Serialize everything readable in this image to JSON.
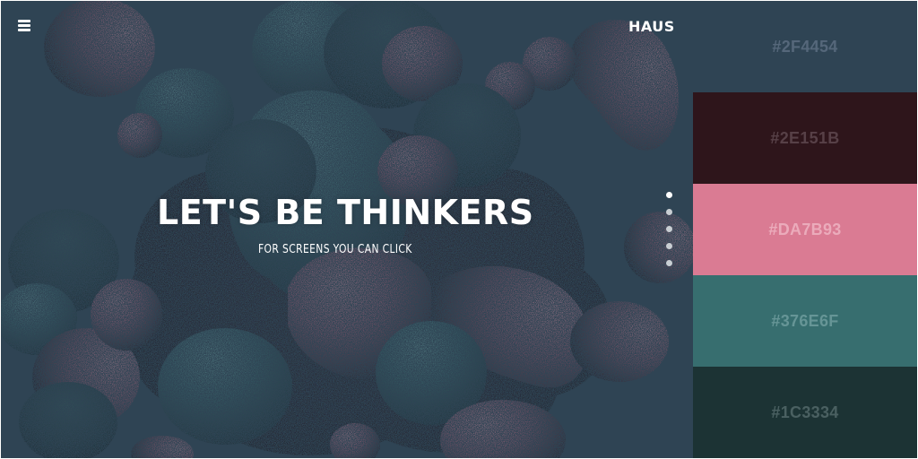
{
  "header": {
    "logo": "HAUS",
    "menu_icon": "hamburger-menu-icon"
  },
  "hero": {
    "title": "LET'S BE THINKERS",
    "subtitle": "FOR SCREENS YOU CAN CLICK"
  },
  "pager": {
    "count": 5,
    "active_index": 0
  },
  "palette": [
    {
      "label": "#2F4454",
      "color": "#2f4454",
      "text_color": "#55677a"
    },
    {
      "label": "#2E151B",
      "color": "#2e151b",
      "text_color": "#574047"
    },
    {
      "label": "#DA7B93",
      "color": "#da7b93",
      "text_color": "#ebabbb"
    },
    {
      "label": "#376E6F",
      "color": "#376e6f",
      "text_color": "#669596"
    },
    {
      "label": "#1C3334",
      "color": "#1c3334",
      "text_color": "#4a6061"
    }
  ],
  "colors": {
    "background": "#2f4454",
    "blob_pink": "#da7b93",
    "blob_teal": "#376e6f",
    "blob_dark": "#2e151b",
    "blob_darkteal": "#1c3334"
  }
}
